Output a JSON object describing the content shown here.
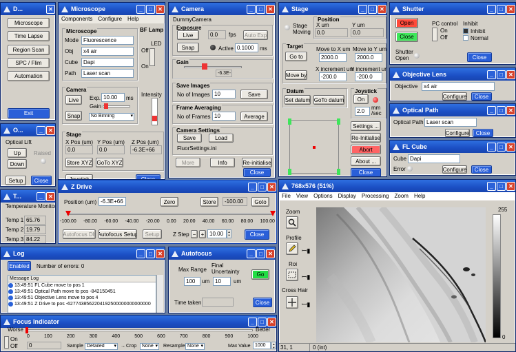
{
  "desktop": {
    "bg": "#6a7ea0"
  },
  "dwin": {
    "title": "D...",
    "buttons": [
      "Microscope",
      "Time Lapse",
      "Region Scan",
      "SPC / Flim",
      "Automation"
    ],
    "exit_label": "Exit"
  },
  "owin": {
    "title": "O...",
    "optical_lift_label": "Optical Lift",
    "raised_label": "Raised",
    "up_label": "Up",
    "down_label": "Down",
    "setup_label": "Setup",
    "close_label": "Close"
  },
  "twin": {
    "title": "T...",
    "header": "Temperature Monitor",
    "temps": [
      {
        "label": "Temp 1",
        "value": "65.76"
      },
      {
        "label": "Temp 2",
        "value": "19.79"
      },
      {
        "label": "Temp 3",
        "value": "84.22"
      }
    ]
  },
  "microscope": {
    "title": "Microscope",
    "menu": [
      "Components",
      "Configure",
      "Help"
    ],
    "group_label": "Microscope",
    "mode_label": "Mode",
    "mode_value": "Fluorescence",
    "obj_label": "Obj",
    "obj_value": "x4 air",
    "cube_label": "Cube",
    "cube_value": "Dapi",
    "path_label": "Path",
    "path_value": "Laser scan",
    "bf_lamp_label": "BF Lamp",
    "led_label": "LED",
    "off_label": "Off",
    "on_label": "On",
    "intensity_label": "Intensity",
    "camera_group": "Camera",
    "live_label": "Live",
    "exp_label": "Exp.",
    "exp_value": "10.00",
    "exp_unit": "ms",
    "gain_label": "Gain",
    "snap_label": "Snap",
    "binning_value": "No Binning",
    "stage_group": "Stage",
    "xpos_label": "X Pos (um)",
    "xpos_value": "0.0",
    "ypos_label": "Y Pos (um)",
    "ypos_value": "0.0",
    "zpos_label": "Z Pos (um)",
    "zpos_value": "-6.3E+66",
    "store_xyz_label": "Store XYZ",
    "goto_xyz_label": "GoTo XYZ",
    "joystick_label": "Joystick",
    "close_label": "Close"
  },
  "camera": {
    "title": "Camera",
    "device": "DummyCamera",
    "exposure_group": "Exposure",
    "live_label": "Live",
    "fps_value": "0.0",
    "fps_unit": "fps",
    "auto_exp_label": "Auto Exp",
    "snap_label": "Snap",
    "active_label": "Active",
    "active_value": "0.1000",
    "active_unit": "ms",
    "gain_group": "Gain",
    "gain_value": "-6.3E-",
    "save_images_group": "Save Images",
    "no_images_label": "No of Images",
    "no_images_value": "10",
    "save_label": "Save",
    "frame_avg_group": "Frame Averaging",
    "no_frames_label": "No of Frames",
    "no_frames_value": "10",
    "average_label": "Average",
    "settings_group": "Camera Settings",
    "settings_save_label": "Save",
    "load_label": "Load",
    "settings_file": "FluorSettings.ini",
    "more_label": "More",
    "info_label": "Info",
    "reinit_label": "Re-initialise",
    "close_label": "Close"
  },
  "stage": {
    "title": "Stage",
    "stage_moving_label": "Stage Moving",
    "position_group": "Position",
    "x_um_label": "X um",
    "x_um_value": "0.0",
    "y_um_label": "Y um",
    "y_um_value": "0.0",
    "target_group": "Target",
    "goto_label": "Go to",
    "move_x_label": "Move to X um",
    "move_x_value": "2000.0",
    "move_y_label": "Move to Y um",
    "move_y_value": "2000.0",
    "move_by_label": "Move by",
    "xinc_label": "X increment um",
    "xinc_value": "-200.0",
    "yinc_label": "Y increment um",
    "yinc_value": "-200.0",
    "datum_group": "Datum",
    "set_datum_label": "Set datum",
    "goto_datum_label": "GoTo datum",
    "joystick_group": "Joystick",
    "on_label": "On",
    "speed_value": "2.0",
    "speed_unit": "mm /sec",
    "settings_label": "Settings ...",
    "reinit_label": "Re-Initialise",
    "abort_label": "Abort",
    "about_label": "About ...",
    "close_label": "Close"
  },
  "shutter": {
    "title": "Shutter",
    "open_label": "Open",
    "close_btn_label": "Close",
    "pc_control_label": "PC control",
    "pc_on": "On",
    "pc_off": "Off",
    "inhibit_label": "Inhibit",
    "inhibit_opt": "Inhibit",
    "normal_opt": "Normal",
    "shutter_open_label": "Shutter Open",
    "close_label": "Close"
  },
  "objective": {
    "title": "Objective Lens",
    "label": "Objective",
    "value": "x4 air",
    "configure_label": "Configure",
    "close_label": "Close"
  },
  "optical_path": {
    "title": "Optical Path",
    "label": "Optical Path",
    "value": "Laser scan",
    "configure_label": "Configure",
    "close_label": "Close"
  },
  "fl_cube": {
    "title": "FL Cube",
    "label": "Cube",
    "value": "Dapi",
    "error_label": "Error",
    "configure_label": "Configure",
    "close_label": "Close"
  },
  "zdrive": {
    "title": "Z Drive",
    "position_label": "Position (um)",
    "position_value": "-6.3E+66",
    "zero_label": "Zero",
    "store_label": "Store",
    "store_value": "-100.00",
    "goto_label": "Goto",
    "ticks": [
      "-100.00",
      "-80.00",
      "-60.00",
      "-40.00",
      "-20.00",
      "0.00",
      "20.00",
      "40.00",
      "60.00",
      "80.00",
      "100.00"
    ],
    "autofocus_dlt_label": "Autofocus Dlt",
    "autofocus_setup_label": "Autofocus Setup",
    "setup_label": "Setup",
    "zstep_label": "Z Step",
    "zstep_value": "10.00",
    "close_label": "Close"
  },
  "image": {
    "title": "768x576 (51%)",
    "menu": [
      "File",
      "View",
      "Options",
      "Display",
      "Processing",
      "Zoom",
      "Help"
    ],
    "zoom_label": "Zoom",
    "profile_label": "Profile",
    "roi_label": "Roi",
    "crosshair_label": "Cross Hair",
    "scale_max": "255",
    "scale_min": "0",
    "status_coords": "31, 1",
    "status_value": "0 (int)"
  },
  "log": {
    "title": "Log",
    "enabled_label": "Enabled",
    "errors_label": "Number of errors: 0",
    "header": "Message Log",
    "lines": [
      "13:49:51 FL Cube move to pos 1",
      "13:49:51 Optical Path move to pos -842150451",
      "13:49:51 Objective Lens move to pos 4",
      "13:49:51 Z Drive to pos -6277438562204192500000000000000"
    ]
  },
  "autofocus": {
    "title": "Autofocus",
    "max_range_label": "Max Range",
    "max_range_value": "100",
    "max_range_unit": "um",
    "final_unc_label": "Final Uncertainty",
    "final_unc_value": "10",
    "final_unc_unit": "um",
    "go_label": "Go",
    "time_taken_label": "Time taken",
    "close_label": "Close"
  },
  "focus": {
    "title": "Focus Indicator",
    "worse_label": "Worse",
    "better_label": "Better",
    "on_label": "On",
    "off_label": "Off",
    "readout": "0",
    "ticks": [
      "0",
      "100",
      "200",
      "300",
      "400",
      "500",
      "600",
      "700",
      "800",
      "900",
      "1000"
    ],
    "sample_label": "Sample",
    "sample_value": "Detailed",
    "crop_label": "Crop",
    "crop_value": "None",
    "resample_label": "Resample",
    "resample_value": "None",
    "max_value_label": "Max Value",
    "max_value": "1000"
  }
}
